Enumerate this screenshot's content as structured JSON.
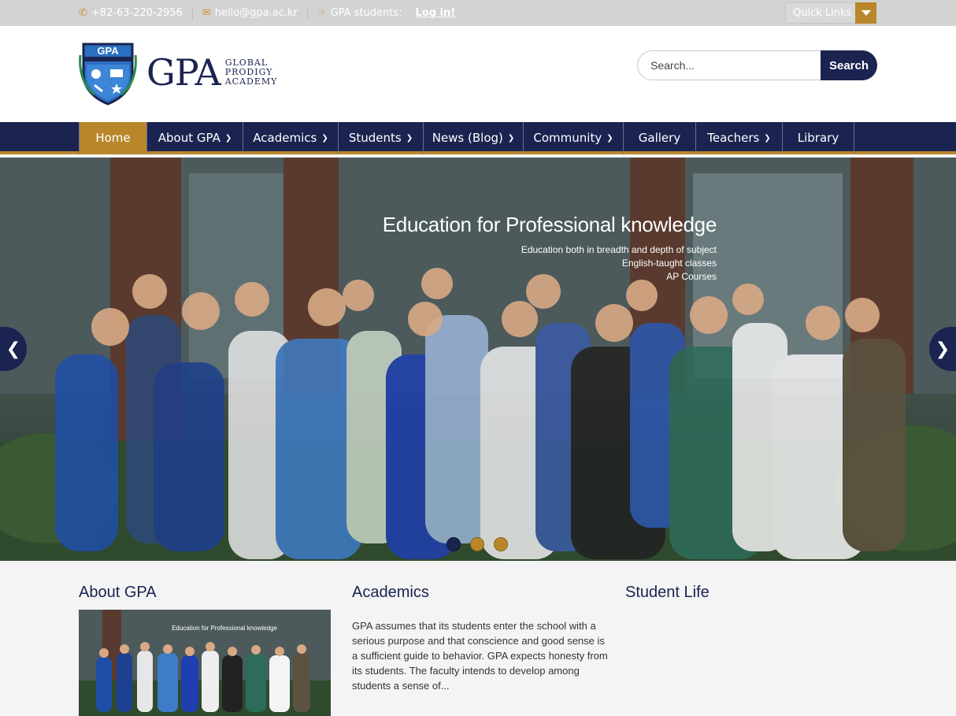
{
  "topbar": {
    "phone": "+82-63-220-2956",
    "email": "hello@gpa.ac.kr",
    "students_label": "GPA students:",
    "login": "Log in!",
    "quick_links": "Quick Links"
  },
  "header": {
    "logo_main": "GPA",
    "logo_sub_1": "GLOBAL",
    "logo_sub_2": "PRODIGY",
    "logo_sub_3": "ACADEMY",
    "crest_text": "GPA",
    "search_placeholder": "Search...",
    "search_button": "Search"
  },
  "nav": {
    "items": [
      {
        "label": "Home",
        "dropdown": false,
        "active": true
      },
      {
        "label": "About GPA",
        "dropdown": true
      },
      {
        "label": "Academics",
        "dropdown": true
      },
      {
        "label": "Students",
        "dropdown": true
      },
      {
        "label": "News (Blog)",
        "dropdown": true
      },
      {
        "label": "Community",
        "dropdown": true
      },
      {
        "label": "Gallery",
        "dropdown": false
      },
      {
        "label": "Teachers",
        "dropdown": true
      },
      {
        "label": "Library",
        "dropdown": false
      }
    ]
  },
  "slider": {
    "title": "Education for Professional knowledge",
    "lines": [
      "Education both in breadth and depth of subject",
      "English-taught classes",
      "AP Courses"
    ],
    "active_slide": 1,
    "slide_count": 3
  },
  "sections": {
    "about": {
      "title": "About GPA"
    },
    "academics": {
      "title": "Academics",
      "text": "GPA assumes that its students enter the school with a serious purpose and that conscience and good sense is a sufficient guide to behavior. GPA expects honesty from its students. The faculty intends to develop among students a sense of..."
    },
    "student_life": {
      "title": "Student Life"
    }
  },
  "colors": {
    "navy": "#1b2350",
    "gold": "#b9872a"
  }
}
